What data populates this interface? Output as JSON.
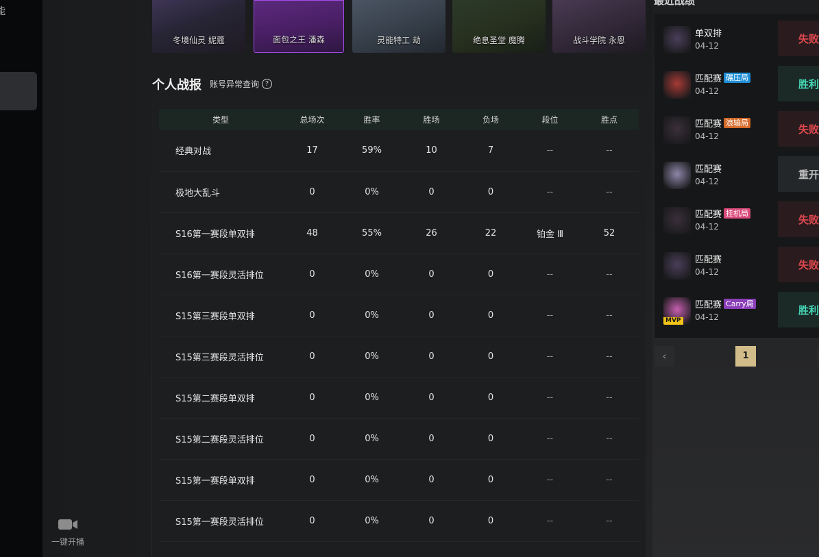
{
  "nav": {
    "cut_char": "能",
    "stream_label": "一键开播"
  },
  "skins": [
    {
      "name": "冬境仙灵 妮蔻",
      "selected": false
    },
    {
      "name": "面包之王 潘森",
      "selected": true
    },
    {
      "name": "灵能特工 劫",
      "selected": false
    },
    {
      "name": "绝息圣堂 魔腾",
      "selected": false
    },
    {
      "name": "战斗学院 永恩",
      "selected": false
    }
  ],
  "stats": {
    "title": "个人战报",
    "anomaly_link": "账号异常查询",
    "help_glyph": "?",
    "columns": [
      "类型",
      "总场次",
      "胜率",
      "胜场",
      "负场",
      "段位",
      "胜点"
    ],
    "rows": [
      [
        "经典对战",
        "17",
        "59%",
        "10",
        "7",
        "--",
        "--"
      ],
      [
        "极地大乱斗",
        "0",
        "0%",
        "0",
        "0",
        "--",
        "--"
      ],
      [
        "S16第一赛段单双排",
        "48",
        "55%",
        "26",
        "22",
        "铂金 Ⅲ",
        "52"
      ],
      [
        "S16第一赛段灵活排位",
        "0",
        "0%",
        "0",
        "0",
        "--",
        "--"
      ],
      [
        "S15第三赛段单双排",
        "0",
        "0%",
        "0",
        "0",
        "--",
        "--"
      ],
      [
        "S15第三赛段灵活排位",
        "0",
        "0%",
        "0",
        "0",
        "--",
        "--"
      ],
      [
        "S15第二赛段单双排",
        "0",
        "0%",
        "0",
        "0",
        "--",
        "--"
      ],
      [
        "S15第二赛段灵活排位",
        "0",
        "0%",
        "0",
        "0",
        "--",
        "--"
      ],
      [
        "S15第一赛段单双排",
        "0",
        "0%",
        "0",
        "0",
        "--",
        "--"
      ],
      [
        "S15第一赛段灵活排位",
        "0",
        "0%",
        "0",
        "0",
        "--",
        "--"
      ]
    ]
  },
  "matches": {
    "header_cut": "最近战绩",
    "items": [
      {
        "mode": "单双排",
        "tag": "",
        "tag_color": "",
        "date": "04-12",
        "result": "失败",
        "result_type": "loss",
        "champ_color": "#4a3f5a"
      },
      {
        "mode": "匹配赛",
        "tag": "碾压局",
        "tag_color": "#1f8fd6",
        "date": "04-12",
        "result": "胜利",
        "result_type": "win",
        "champ_color": "#a63a36"
      },
      {
        "mode": "匹配赛",
        "tag": "浪输局",
        "tag_color": "#d46a2a",
        "date": "04-12",
        "result": "失败",
        "result_type": "loss",
        "champ_color": "#3a2f3a"
      },
      {
        "mode": "匹配赛",
        "tag": "",
        "tag_color": "",
        "date": "04-12",
        "result": "重开",
        "result_type": "remake",
        "champ_color": "#8e86a8"
      },
      {
        "mode": "匹配赛",
        "tag": "挂机局",
        "tag_color": "#d94a7a",
        "date": "04-12",
        "result": "失败",
        "result_type": "loss",
        "champ_color": "#3a2f3a"
      },
      {
        "mode": "匹配赛",
        "tag": "",
        "tag_color": "",
        "date": "04-12",
        "result": "失败",
        "result_type": "loss",
        "champ_color": "#4a3f5a"
      },
      {
        "mode": "匹配赛",
        "tag": "Carry局",
        "tag_color": "#8a3fb8",
        "date": "04-12",
        "result": "胜利",
        "result_type": "win",
        "champ_color": "#c65fb0",
        "mvp": "MVP"
      }
    ]
  },
  "pagination": {
    "prev_glyph": "‹",
    "current": "1"
  }
}
